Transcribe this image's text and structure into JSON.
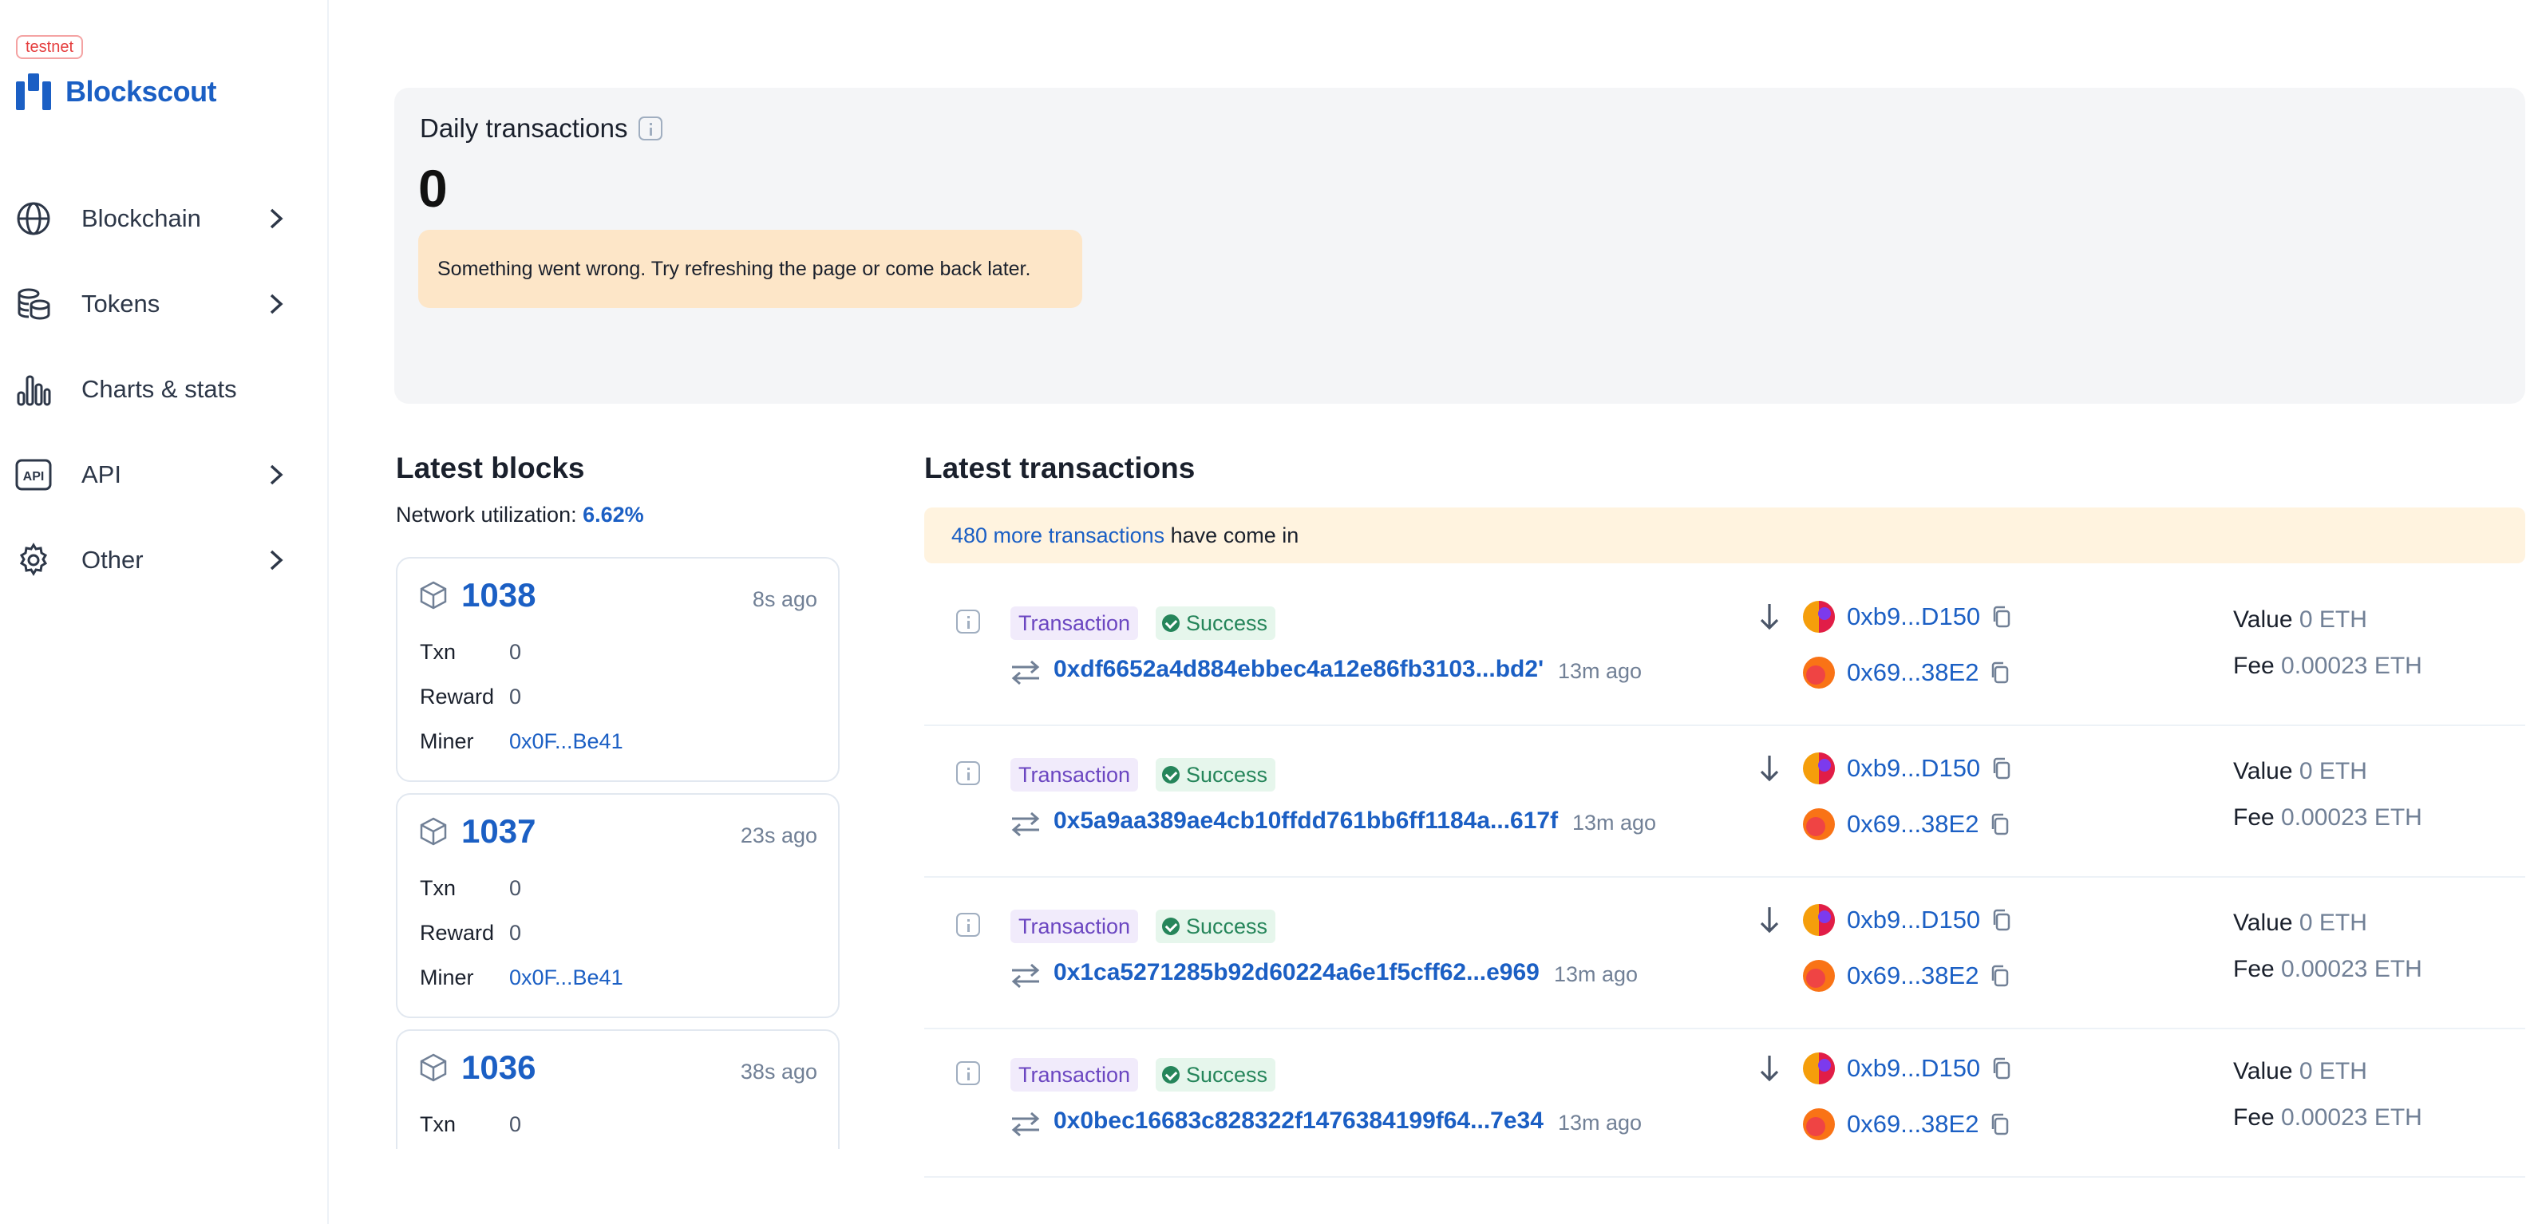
{
  "sidebar": {
    "network_badge": "testnet",
    "logo_text": "Blockscout",
    "items": [
      {
        "label": "Blockchain",
        "icon": "globe-icon",
        "has_chevron": true
      },
      {
        "label": "Tokens",
        "icon": "coins-icon",
        "has_chevron": true
      },
      {
        "label": "Charts & stats",
        "icon": "bar-chart-icon",
        "has_chevron": false
      },
      {
        "label": "API",
        "icon": "api-icon",
        "has_chevron": true
      },
      {
        "label": "Other",
        "icon": "gear-icon",
        "has_chevron": true
      }
    ]
  },
  "daily": {
    "title": "Daily transactions",
    "value": "0",
    "error": "Something went wrong. Try refreshing the page or come back later."
  },
  "latest_blocks": {
    "title": "Latest blocks",
    "util_label": "Network utilization: ",
    "util_value": "6.62%",
    "blocks": [
      {
        "number": "1038",
        "ago": "8s ago",
        "txn_label": "Txn",
        "txn": "0",
        "reward_label": "Reward",
        "reward": "0",
        "miner_label": "Miner",
        "miner": "0x0F...Be41"
      },
      {
        "number": "1037",
        "ago": "23s ago",
        "txn_label": "Txn",
        "txn": "0",
        "reward_label": "Reward",
        "reward": "0",
        "miner_label": "Miner",
        "miner": "0x0F...Be41"
      },
      {
        "number": "1036",
        "ago": "38s ago",
        "txn_label": "Txn",
        "txn": "0"
      }
    ]
  },
  "latest_transactions": {
    "title": "Latest transactions",
    "more_link": "480 more transactions",
    "more_suffix": " have come in",
    "rows": [
      {
        "type": "Transaction",
        "status": "Success",
        "hash": "0xdf6652a4d884ebbec4a12e86fb3103...bd2'",
        "ago": "13m ago",
        "from": "0xb9...D150",
        "to": "0x69...38E2",
        "value_label": "Value",
        "value": "0 ETH",
        "fee_label": "Fee",
        "fee": "0.00023 ETH"
      },
      {
        "type": "Transaction",
        "status": "Success",
        "hash": "0x5a9aa389ae4cb10ffdd761bb6ff1184a...617f",
        "ago": "13m ago",
        "from": "0xb9...D150",
        "to": "0x69...38E2",
        "value_label": "Value",
        "value": "0 ETH",
        "fee_label": "Fee",
        "fee": "0.00023 ETH"
      },
      {
        "type": "Transaction",
        "status": "Success",
        "hash": "0x1ca5271285b92d60224a6e1f5cff62...e969",
        "ago": "13m ago",
        "from": "0xb9...D150",
        "to": "0x69...38E2",
        "value_label": "Value",
        "value": "0 ETH",
        "fee_label": "Fee",
        "fee": "0.00023 ETH"
      },
      {
        "type": "Transaction",
        "status": "Success",
        "hash": "0x0bec16683c828322f1476384199f64...7e34",
        "ago": "13m ago",
        "from": "0xb9...D150",
        "to": "0x69...38E2",
        "value_label": "Value",
        "value": "0 ETH",
        "fee_label": "Fee",
        "fee": "0.00023 ETH"
      }
    ]
  },
  "colors": {
    "accent": "#1b5fc4",
    "success": "#25855a",
    "type_badge": "#6b46c1",
    "warning_bg": "#fde6c8"
  }
}
